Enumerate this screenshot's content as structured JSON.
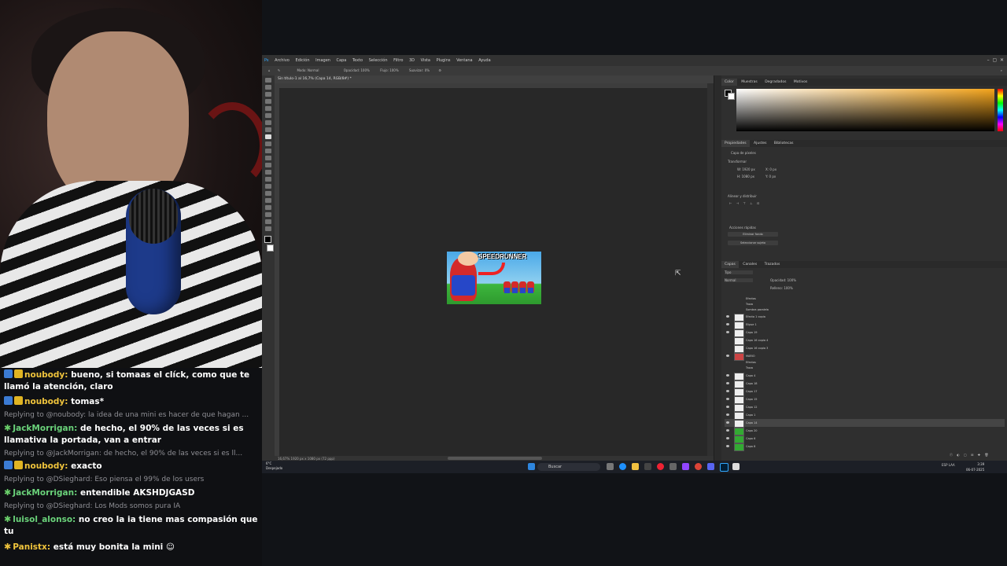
{
  "chat": {
    "messages": [
      {
        "user": "noubody",
        "text": "bueno, si tomaas el clíck, como que te llamó la atención, claro",
        "reply": null,
        "badges": "blue-crown",
        "color": "#f0c43c"
      },
      {
        "user": "noubody",
        "text": "tomas*",
        "reply": null,
        "badges": "blue-crown",
        "color": "#f0c43c"
      },
      {
        "user": "JackMorrigan",
        "text": "de hecho, el 90% de las veces si es llamativa la portada, van a entrar",
        "reply": "Replying to @noubody: la idea de una mini es hacer de que hagan ...",
        "badges": "star",
        "color": "#6ad27a"
      },
      {
        "user": "noubody",
        "text": "exacto",
        "reply": "Replying to @JackMorrigan: de hecho, el 90% de las veces si es ll...",
        "badges": "blue-crown",
        "color": "#f0c43c"
      },
      {
        "user": "JackMorrigan",
        "text": "entendible AKSHDJGASD",
        "reply": "Replying to @DSieghard: Eso piensa el 99% de los users",
        "badges": "star",
        "color": "#6ad27a"
      },
      {
        "user": "luisol_alonso",
        "text": "no creo la ia tiene mas compasión que tu",
        "reply": "Replying to @DSieghard: Los Mods somos pura IA",
        "badges": "star",
        "color": "#6ad27a"
      },
      {
        "user": "Panistx",
        "text": "está muy bonita la mini",
        "reply": null,
        "badges": "star",
        "color": "#f0c43c"
      }
    ]
  },
  "photoshop": {
    "menu": [
      "Archivo",
      "Edición",
      "Imagen",
      "Capa",
      "Texto",
      "Selección",
      "Filtro",
      "3D",
      "Vista",
      "Plugins",
      "Ventana",
      "Ayuda"
    ],
    "options": {
      "mode_label": "Modo:",
      "mode_value": "Normal",
      "opacity_label": "Opacidad:",
      "opacity_value": "100%",
      "flow_label": "Flujo:",
      "flow_value": "100%",
      "smooth_label": "Suavizar:",
      "smooth_value": "0%"
    },
    "doc_tab": "Sin título-1 al 16,7% (Capa 14, RGB/8#) *",
    "status": "16,67%   1920 px x 1080 px (72 ppp)",
    "thumbnail_text": "SPEEDRUNNER",
    "color_tabs": [
      "Color",
      "Muestras",
      "Degradados",
      "Motivos"
    ],
    "prop_tabs": [
      "Propiedades",
      "Ajustes",
      "Bibliotecas"
    ],
    "prop_doc": "Capa de píxeles",
    "transform_label": "Transformar",
    "w": "W: 1920 px",
    "h": "H: 1080 px",
    "x": "X: 0 px",
    "y": "Y: 0 px",
    "align_label": "Alinear y distribuir",
    "quick_actions": "Acciones rápidas",
    "remove_bg": "Eliminar fondo",
    "select_subject": "Seleccionar sujeto",
    "layer_tabs": [
      "Capas",
      "Canales",
      "Trazados"
    ],
    "layer_kind": "Tipo",
    "blend": "Normal",
    "opacity": "Opacidad: 100%",
    "fill": "Relleno: 100%",
    "layers": [
      "Efectos",
      "Trazo",
      "Sombra paralela",
      "Efecto 1 copia",
      "Elipse 1",
      "Capa 19",
      "Capa 16 copia 4",
      "Capa 16 copia 3",
      "MARIO",
      "Efectos",
      "Trazo",
      "Capa 4",
      "Capa 18",
      "Capa 17",
      "Capa 15",
      "Capa 12",
      "Capa 1",
      "Capa 14",
      "Capa 20",
      "Capa 6",
      "Capa 8"
    ]
  },
  "taskbar": {
    "weather_temp": "6°C",
    "weather_desc": "Despejado",
    "search": "Buscar",
    "lang": "ESP LAA",
    "time": "3:39",
    "date": "06-07-2025"
  }
}
